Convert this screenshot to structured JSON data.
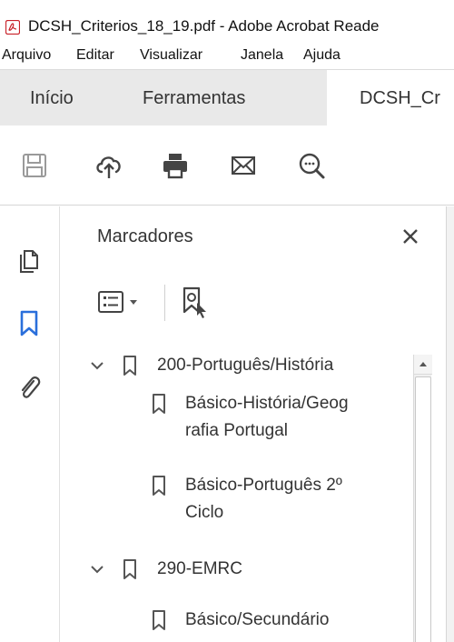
{
  "window": {
    "title": "DCSH_Criterios_18_19.pdf - Adobe Acrobat Reade",
    "app_icon": "acrobat-icon"
  },
  "menubar": {
    "items": [
      "Arquivo",
      "Editar",
      "Visualizar",
      "Janela",
      "Ajuda"
    ]
  },
  "tabs": [
    {
      "label": "Início",
      "active": false
    },
    {
      "label": "Ferramentas",
      "active": false
    },
    {
      "label": "DCSH_Cr",
      "active": true
    }
  ],
  "toolbar": {
    "icons": [
      "save-icon",
      "cloud-upload-icon",
      "print-icon",
      "email-icon",
      "zoom-search-icon"
    ]
  },
  "rail": {
    "icons": [
      "pages-icon",
      "bookmark-icon",
      "attachment-icon"
    ]
  },
  "panel": {
    "title": "Marcadores",
    "close_icon": "close-icon",
    "tools": [
      "options-menu-icon",
      "find-bookmark-icon"
    ]
  },
  "bookmarks": [
    {
      "level": 0,
      "expanded": true,
      "lines": [
        "200-Português/História"
      ]
    },
    {
      "level": 1,
      "lines": [
        "Básico-História/Geog",
        "rafia Portugal"
      ]
    },
    {
      "level": 1,
      "lines": [
        "Básico-Português 2º",
        "Ciclo"
      ]
    },
    {
      "level": 0,
      "expanded": true,
      "lines": [
        "290-EMRC"
      ]
    },
    {
      "level": 1,
      "lines": [
        "Básico/Secundário"
      ]
    }
  ],
  "colors": {
    "accent": "#2a6fdb",
    "icon": "#4a4a4a",
    "tab_bar": "#e9e9e9"
  }
}
